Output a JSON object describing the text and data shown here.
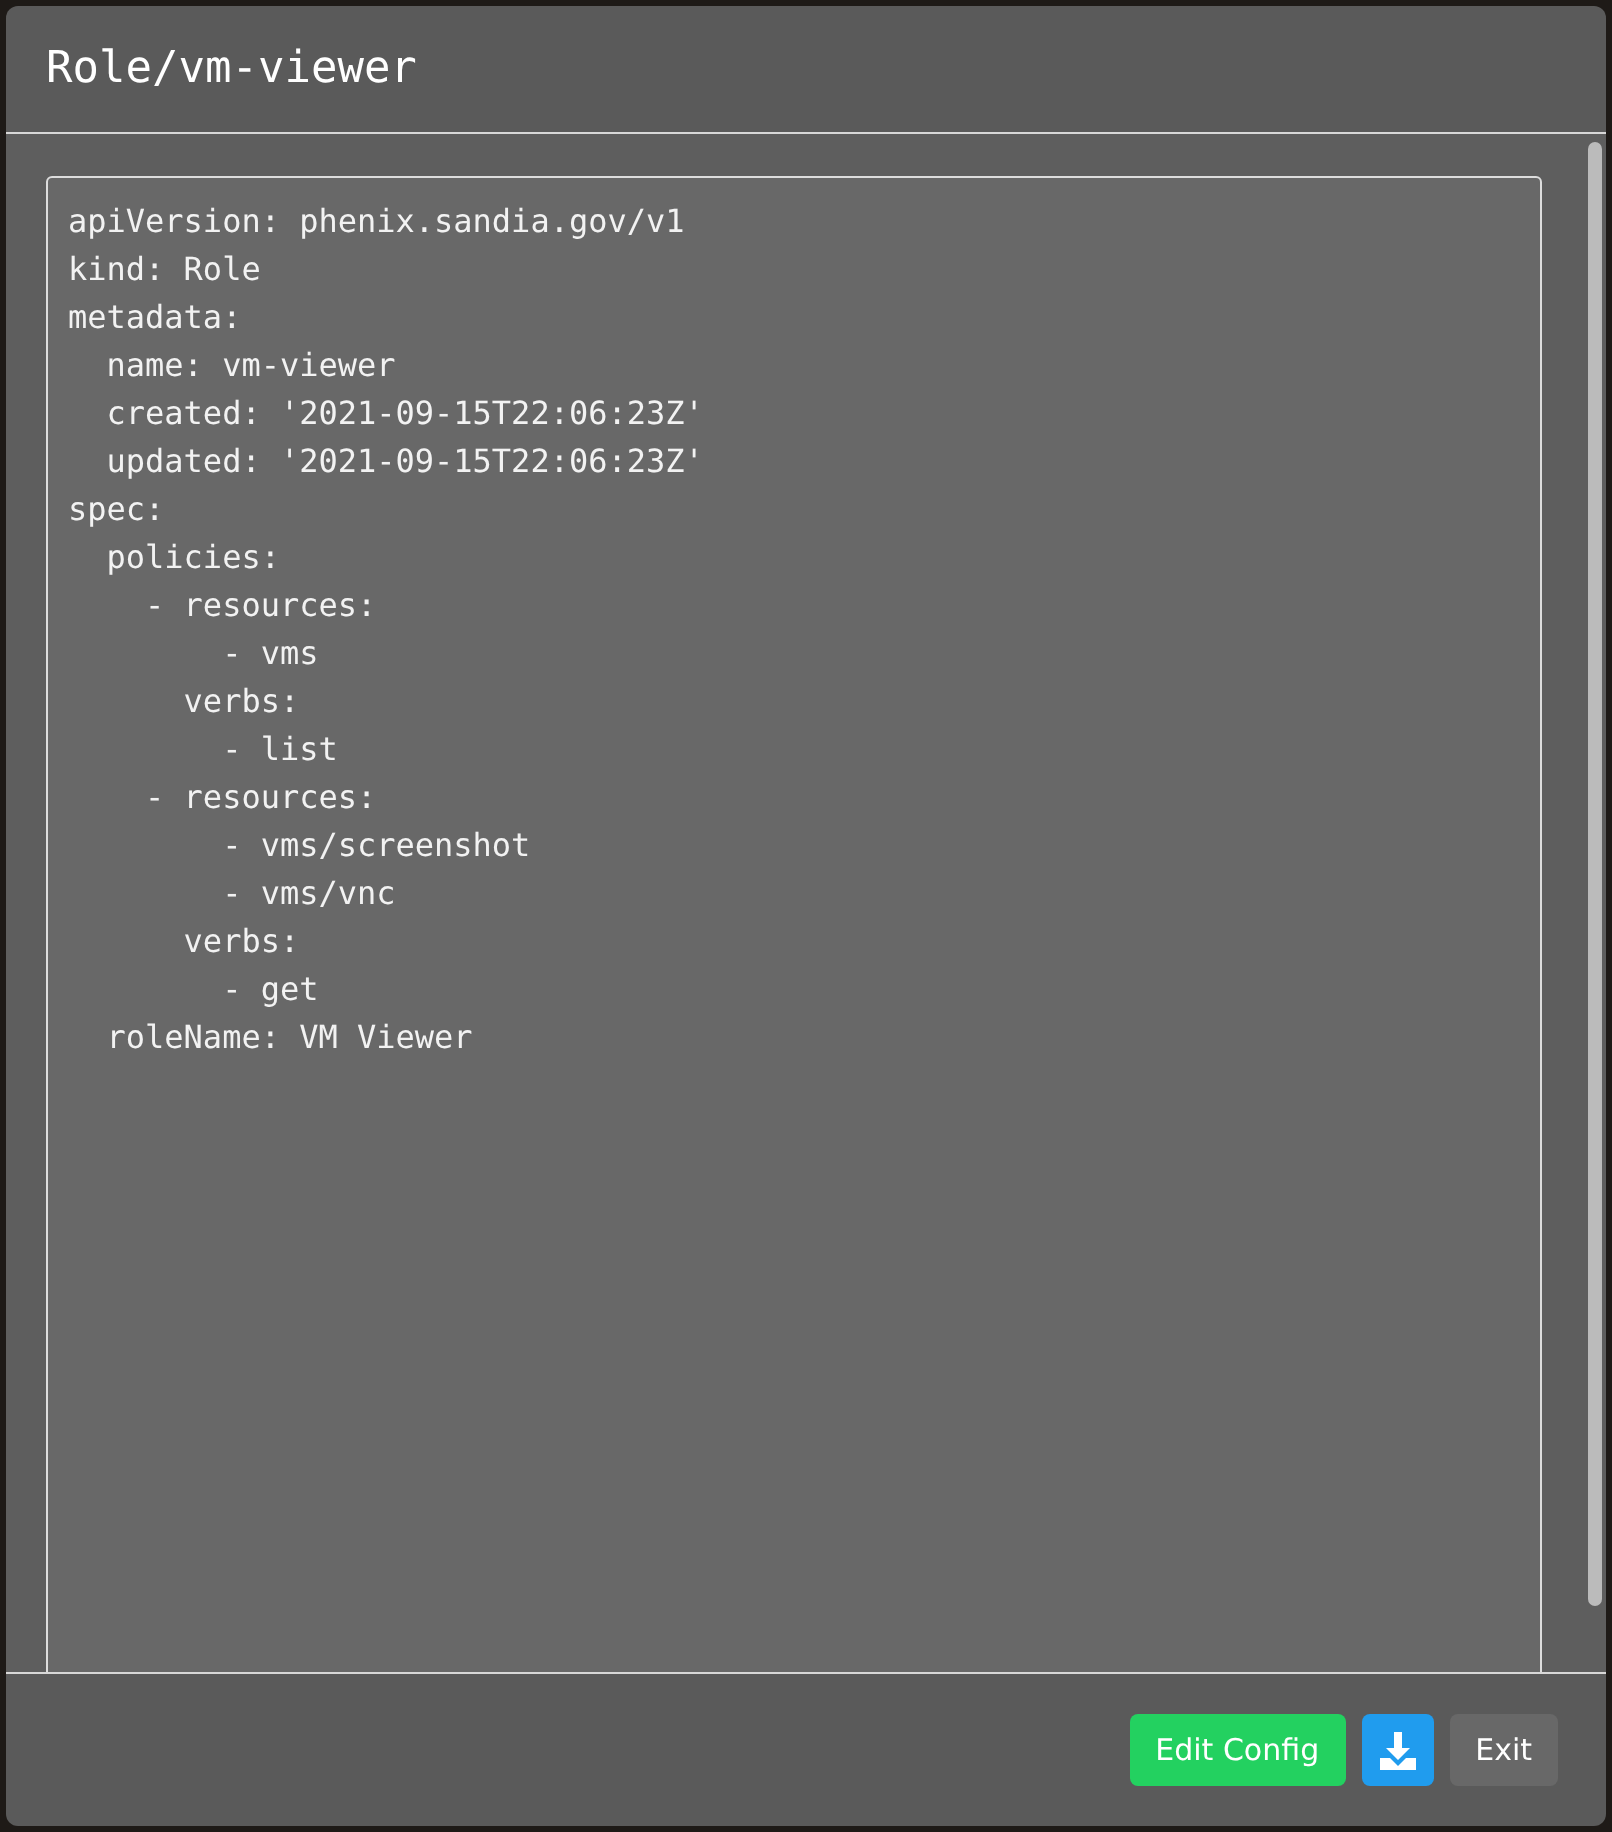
{
  "dialog": {
    "title": "Role/vm-viewer"
  },
  "config_lines": [
    "apiVersion: phenix.sandia.gov/v1",
    "kind: Role",
    "metadata:",
    "  name: vm-viewer",
    "  created: '2021-09-15T22:06:23Z'",
    "  updated: '2021-09-15T22:06:23Z'",
    "spec:",
    "  policies:",
    "    - resources:",
    "        - vms",
    "      verbs:",
    "        - list",
    "    - resources:",
    "        - vms/screenshot",
    "        - vms/vnc",
    "      verbs:",
    "        - get",
    "  roleName: VM Viewer"
  ],
  "buttons": [
    {
      "kind": "text",
      "label": "Edit Config",
      "color": "#23d160"
    },
    {
      "kind": "download",
      "color": "#209cee"
    },
    {
      "kind": "text",
      "label": "Exit",
      "color": "#686868"
    }
  ]
}
